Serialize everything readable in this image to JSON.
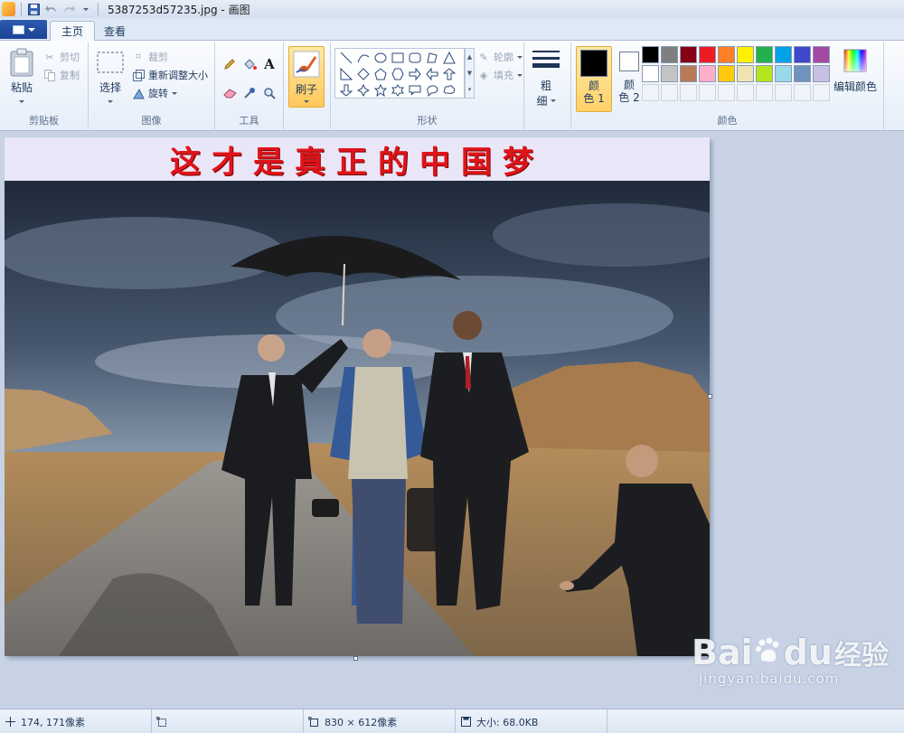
{
  "window": {
    "title": "5387253d57235.jpg - 画图"
  },
  "tabs": {
    "file_label": "",
    "home": "主页",
    "view": "查看"
  },
  "ribbon": {
    "clipboard": {
      "label": "剪贴板",
      "paste": "粘贴",
      "cut": "剪切",
      "copy": "复制"
    },
    "image": {
      "label": "图像",
      "select": "选择",
      "crop": "裁剪",
      "resize": "重新调整大小",
      "rotate": "旋转"
    },
    "tools": {
      "label": "工具"
    },
    "brushes": {
      "label": "刷子"
    },
    "shapes": {
      "label": "形状",
      "outline": "轮廓",
      "fill": "填充"
    },
    "size": {
      "label_line1": "粗",
      "label_line2": "细"
    },
    "colors": {
      "label": "颜色",
      "color1_line1": "颜",
      "color1_line2": "色 1",
      "color2_line1": "颜",
      "color2_line2": "色 2",
      "edit": "编辑颜色",
      "color1": "#000000",
      "color2": "#ffffff",
      "palette_row1": [
        "#000000",
        "#7f7f7f",
        "#880015",
        "#ed1c24",
        "#ff7f27",
        "#fff200",
        "#22b14c",
        "#00a2e8",
        "#3f48cc",
        "#a349a4"
      ],
      "palette_row2": [
        "#ffffff",
        "#c3c3c3",
        "#b97a57",
        "#ffaec9",
        "#ffc90e",
        "#efe4b0",
        "#b5e61d",
        "#99d9ea",
        "#7092be",
        "#c8bfe7"
      ]
    }
  },
  "canvas": {
    "banner_text": "这才是真正的中国梦"
  },
  "status": {
    "cursor_pos": "174, 171像素",
    "selection_size": "",
    "image_size": "830 × 612像素",
    "file_size": "大小: 68.0KB"
  },
  "watermark": {
    "main": "Bai",
    "main2": "du",
    "cn": "经验",
    "sub": "jingyan.baidu.com"
  }
}
